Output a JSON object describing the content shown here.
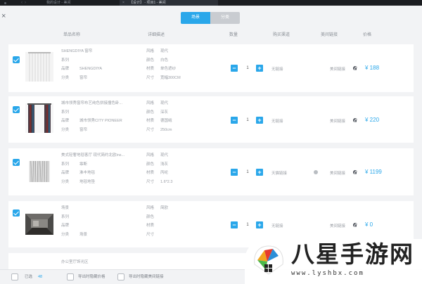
{
  "window": {
    "tabs": [
      {
        "label": "我的设计 - 美间"
      },
      {
        "label": "【设计】 - 项目1 - 美间"
      }
    ]
  },
  "toolbar": {
    "segments": [
      {
        "label": "场景",
        "active": true
      },
      {
        "label": "分类",
        "active": false
      }
    ]
  },
  "table": {
    "columns": {
      "name": "单品名称",
      "desc": "详细描述",
      "qty": "数量",
      "channel": "购买渠道",
      "link": "美间链接",
      "price": "价格"
    },
    "rows": [
      {
        "checked": true,
        "name": "SHENGDIYA 窗帘",
        "series": "",
        "brand": "SHENGDIYA",
        "category": "窗帘",
        "style": "现代",
        "color": "白色",
        "material": "单色遮纱",
        "size": "宽幅300CM",
        "qty": "1",
        "channel": "无链接",
        "link": "美间链接",
        "price": "¥ 188"
      },
      {
        "checked": true,
        "name": "城市领秀窗帘布艺纯色拼接撞色卧...",
        "series": "",
        "brand": "城市领秀CITY PIONEER",
        "category": "窗帘",
        "style": "现代",
        "color": "深灰",
        "material": "德国绒",
        "size": "250cm",
        "qty": "1",
        "channel": "无链接",
        "link": "美间链接",
        "price": "¥ 220"
      },
      {
        "checked": true,
        "name": "美式轻奢地毯客厅 现代简约北欧ins...",
        "series": "霏断",
        "brand": "沸丰地毯",
        "category": "地毯地垫",
        "style": "现代",
        "color": "浅灰",
        "material": "丙纶",
        "size": "1.6*2.3",
        "qty": "1",
        "channel": "天猫链接",
        "link": "美间链接",
        "price": "¥ 1199"
      },
      {
        "checked": true,
        "name": "场景",
        "series": "",
        "brand": "",
        "category": "场景",
        "style": "简欧",
        "color": "",
        "material": "",
        "size": "",
        "qty": "1",
        "channel": "无链接",
        "link": "美间链接",
        "price": "¥ 0"
      }
    ],
    "partial_row": {
      "name": "办公室厅饰光区"
    },
    "labels": {
      "series": "系列",
      "brand": "品牌",
      "category": "分类",
      "style": "风格",
      "color": "颜色",
      "material": "材质",
      "size": "尺寸"
    }
  },
  "footer": {
    "selected_label": "已选",
    "selected_count": "48",
    "export_hide_price": "导出时隐藏价格",
    "export_hide_link": "导出时隐藏美间链接"
  },
  "watermark": {
    "title": "八星手游网",
    "url": "www.lyshbx.com"
  },
  "colors": {
    "accent": "#2aa7ea",
    "background": "#f2f3f5",
    "card": "#ffffff"
  }
}
